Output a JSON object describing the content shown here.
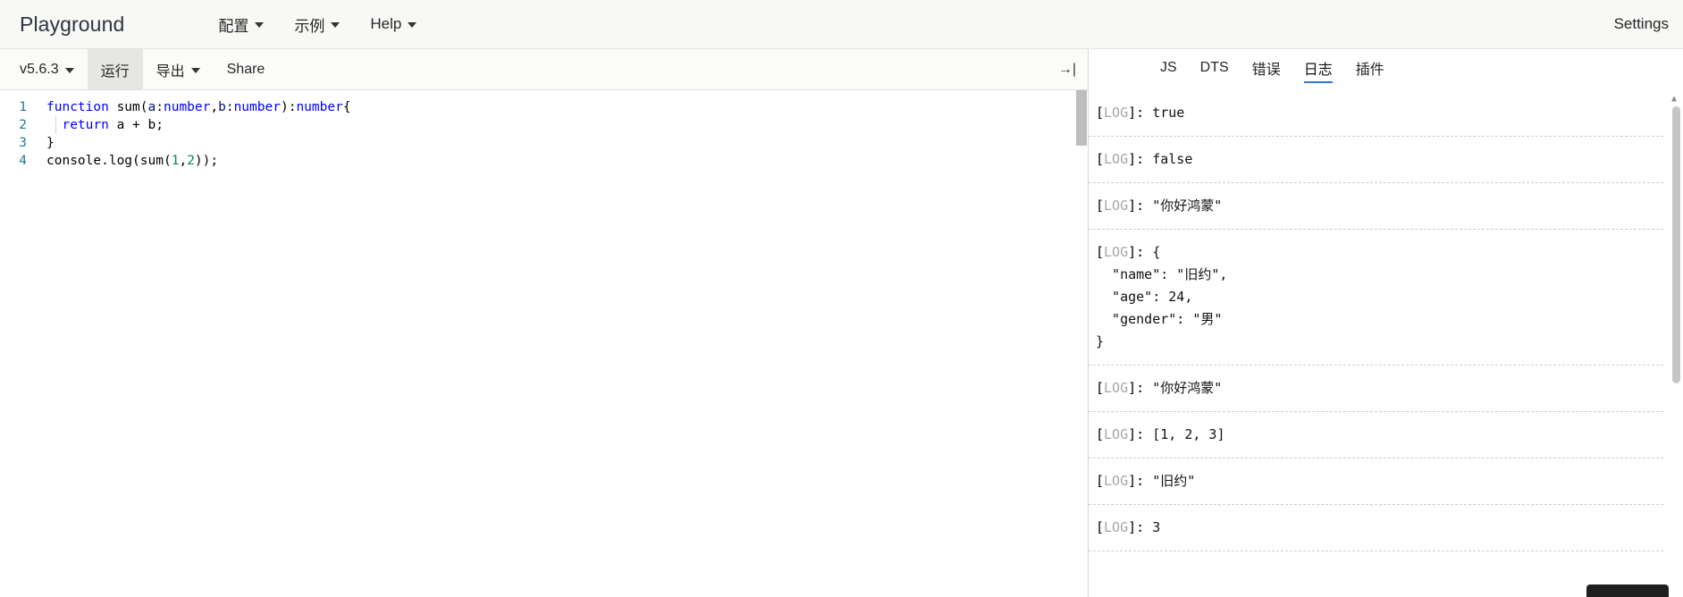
{
  "header": {
    "brand": "Playground",
    "nav": [
      {
        "label": "配置",
        "has_caret": true
      },
      {
        "label": "示例",
        "has_caret": true
      },
      {
        "label": "Help",
        "has_caret": true
      }
    ],
    "settings_label": "Settings"
  },
  "toolbar": {
    "version_label": "v5.6.3",
    "run_label": "运行",
    "export_label": "导出",
    "share_label": "Share",
    "collapse_icon": "→|"
  },
  "editor": {
    "language": "typescript",
    "lines": [
      {
        "n": "1",
        "tokens": [
          {
            "t": "function ",
            "c": "kw"
          },
          {
            "t": "sum",
            "c": "fn"
          },
          {
            "t": "(",
            "c": "pl"
          },
          {
            "t": "a",
            "c": "ident"
          },
          {
            "t": ":",
            "c": "pl"
          },
          {
            "t": "number",
            "c": "kw"
          },
          {
            "t": ",",
            "c": "pl"
          },
          {
            "t": "b",
            "c": "ident"
          },
          {
            "t": ":",
            "c": "pl"
          },
          {
            "t": "number",
            "c": "kw"
          },
          {
            "t": ")",
            "c": "pl"
          },
          {
            "t": ":",
            "c": "pl"
          },
          {
            "t": "number",
            "c": "kw"
          },
          {
            "t": "{",
            "c": "pl"
          }
        ]
      },
      {
        "n": "2",
        "indent_guide": true,
        "tokens": [
          {
            "t": "  ",
            "c": "pl"
          },
          {
            "t": "return",
            "c": "kw"
          },
          {
            "t": " a + b;",
            "c": "pl"
          }
        ]
      },
      {
        "n": "3",
        "tokens": [
          {
            "t": "}",
            "c": "pl"
          }
        ]
      },
      {
        "n": "4",
        "tokens": [
          {
            "t": "console",
            "c": "pl"
          },
          {
            "t": ".",
            "c": "pl"
          },
          {
            "t": "log",
            "c": "pl"
          },
          {
            "t": "(",
            "c": "pl"
          },
          {
            "t": "sum",
            "c": "pl"
          },
          {
            "t": "(",
            "c": "pl"
          },
          {
            "t": "1",
            "c": "num"
          },
          {
            "t": ",",
            "c": "pl"
          },
          {
            "t": "2",
            "c": "num"
          },
          {
            "t": "))",
            "c": "pl"
          },
          {
            "t": ";",
            "c": "pl"
          }
        ]
      }
    ]
  },
  "console": {
    "tabs": [
      {
        "label": "JS",
        "active": false
      },
      {
        "label": "DTS",
        "active": false
      },
      {
        "label": "错误",
        "active": false
      },
      {
        "label": "日志",
        "active": true
      },
      {
        "label": "插件",
        "active": false
      }
    ],
    "log_prefix": "[LOG]:",
    "entries": [
      {
        "value": "true"
      },
      {
        "value": "false"
      },
      {
        "value": "\"你好鸿蒙\""
      },
      {
        "value": "{\n  \"name\": \"旧约\",\n  \"age\": 24,\n  \"gender\": \"男\"\n}"
      },
      {
        "value": "\"你好鸿蒙\""
      },
      {
        "value": "[1, 2, 3]"
      },
      {
        "value": "\"旧约\""
      },
      {
        "value": "3"
      }
    ]
  },
  "colors": {
    "accent": "#3178c6",
    "header_bg": "#f8f8f6",
    "keyword": "#0000ff",
    "number": "#098658",
    "linenumber": "#237893",
    "log_tag": "#a5a5a5"
  }
}
